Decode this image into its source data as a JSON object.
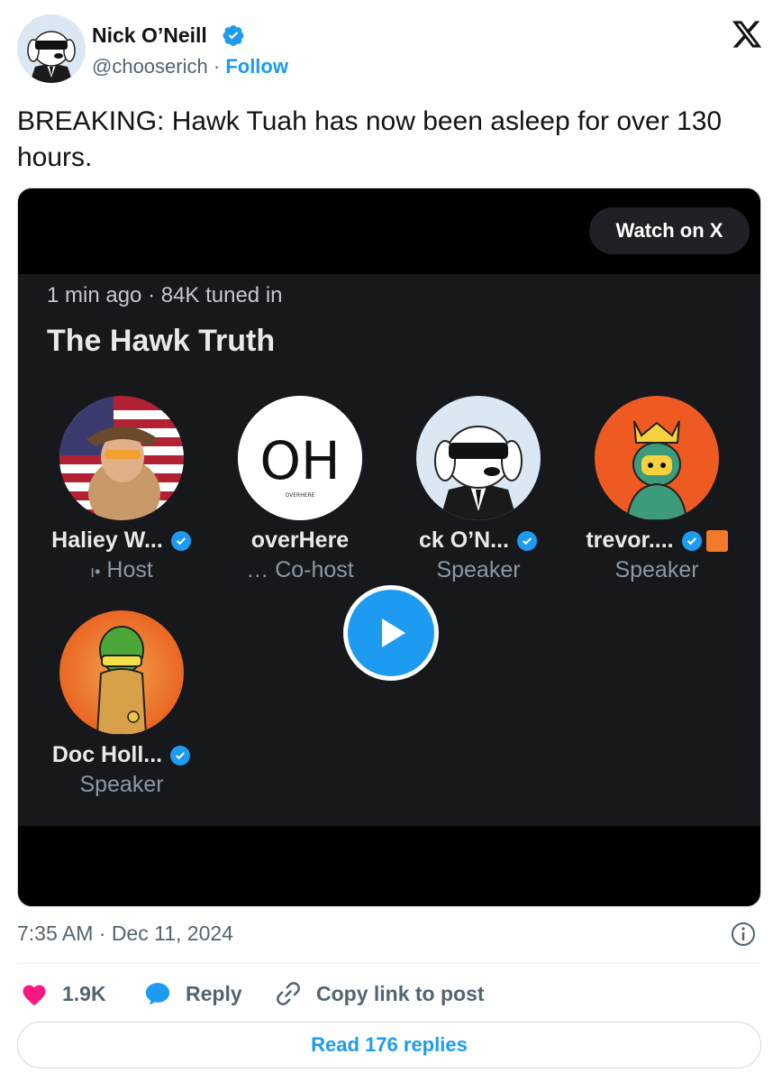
{
  "author": {
    "name": "Nick O’Neill",
    "handle": "@chooserich",
    "separator": "·",
    "follow_label": "Follow"
  },
  "post": {
    "text": "BREAKING: Hawk Tuah has now been asleep for over 130 hours.",
    "timestamp": "7:35 AM · Dec 11, 2024"
  },
  "media": {
    "watch_label": "Watch on X",
    "space": {
      "meta": "1 min ago · 84K tuned in",
      "title": "The Hawk Truth",
      "participants": [
        {
          "name": "Haliey W...",
          "role": "Host",
          "role_prefix": "ı•",
          "verified": true
        },
        {
          "name": "overHere",
          "role": "Co-host",
          "role_prefix": "…",
          "verified": false
        },
        {
          "name": "ck O’N...",
          "role": "Speaker",
          "role_prefix": "",
          "verified": true
        },
        {
          "name": "trevor....",
          "role": "Speaker",
          "role_prefix": "",
          "verified": true
        },
        {
          "name": "Doc Holl...",
          "role": "Speaker",
          "role_prefix": "",
          "verified": true
        }
      ],
      "logo_main": "OH",
      "logo_sub": "OVERHERE"
    }
  },
  "actions": {
    "likes": "1.9K",
    "reply_label": "Reply",
    "copy_label": "Copy link to post"
  },
  "read_replies_label": "Read 176 replies",
  "colors": {
    "accent": "#1d9bf0",
    "like": "#f91880",
    "space_bg": "#16181c"
  },
  "icons": [
    "verified-icon",
    "x-logo-icon",
    "play-icon",
    "info-icon",
    "heart-icon",
    "reply-bubble-icon",
    "link-icon"
  ]
}
